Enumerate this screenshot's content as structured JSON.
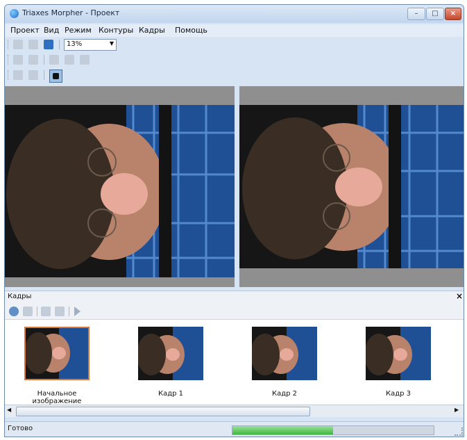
{
  "window": {
    "title": "Triaxes Morpher - Проект",
    "controls": [
      "minimize",
      "maximize",
      "close"
    ]
  },
  "menu": {
    "items": [
      "Проект",
      "Вид",
      "Режим",
      "Контуры",
      "Кадры",
      "Помощь"
    ]
  },
  "toolbar": {
    "zoom_value": "13%",
    "row1_icons": [
      "new-file-icon",
      "open-file-icon",
      "save-icon"
    ],
    "row2_icons": [
      "select-arrow-icon",
      "move-icon",
      "next-icon",
      "lasso-icon",
      "eraser-icon"
    ],
    "row3_icons": [
      "image-icon",
      "grid-icon",
      "view-mode-icon"
    ]
  },
  "panel": {
    "title": "Кадры",
    "close_label": "×",
    "tool_icons": [
      "add-frame-icon",
      "delete-frame-icon",
      "film-icon",
      "render-icon",
      "play-icon"
    ]
  },
  "frames": [
    {
      "label": "Начальное изображение",
      "selected": true
    },
    {
      "label": "Кадр 1",
      "selected": false
    },
    {
      "label": "Кадр 2",
      "selected": false
    },
    {
      "label": "Кадр 3",
      "selected": false
    }
  ],
  "status": {
    "text": "Готово",
    "progress": 0.5
  },
  "colors": {
    "titlebar": "#c3d6ee",
    "selection_border": "#d87838",
    "progress_fill": "#3fb63f"
  }
}
